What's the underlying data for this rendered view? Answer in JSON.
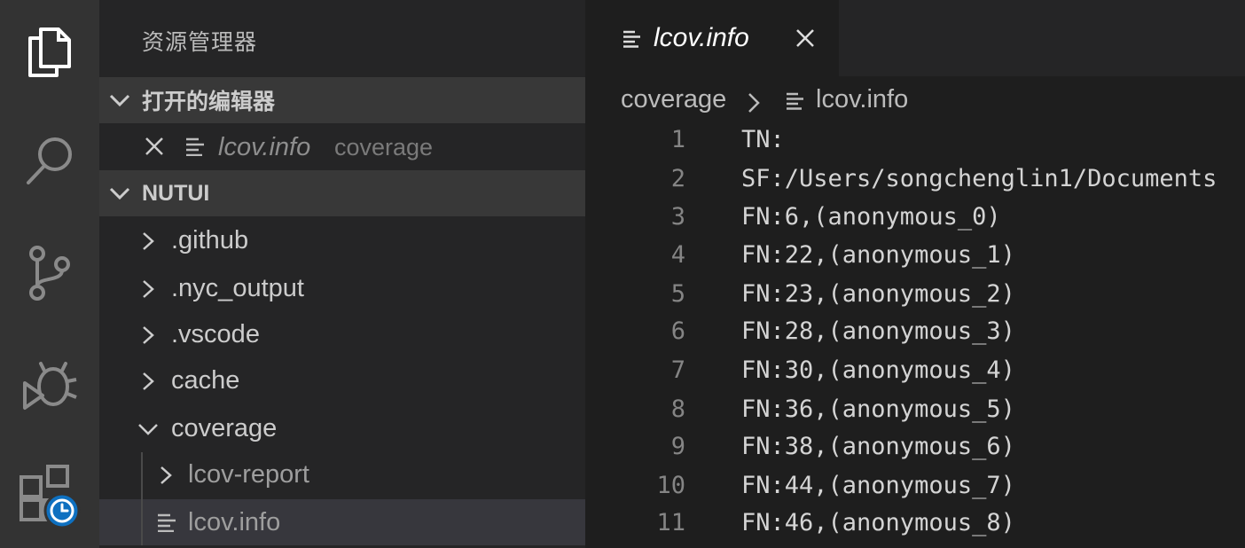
{
  "activity_bar": {
    "items": [
      {
        "name": "explorer-icon"
      },
      {
        "name": "search-icon"
      },
      {
        "name": "source-control-icon"
      },
      {
        "name": "debug-icon"
      },
      {
        "name": "extensions-icon"
      }
    ]
  },
  "sidebar": {
    "title": "资源管理器",
    "open_editors": {
      "header": "打开的编辑器",
      "items": [
        {
          "name": "lcov.info",
          "description": "coverage"
        }
      ]
    },
    "workspace": {
      "header": "NUTUI",
      "items": [
        {
          "label": ".github",
          "type": "folder",
          "expanded": false
        },
        {
          "label": ".nyc_output",
          "type": "folder",
          "expanded": false
        },
        {
          "label": ".vscode",
          "type": "folder",
          "expanded": false
        },
        {
          "label": "cache",
          "type": "folder",
          "expanded": false
        },
        {
          "label": "coverage",
          "type": "folder",
          "expanded": true
        },
        {
          "label": "lcov-report",
          "type": "folder",
          "expanded": false
        },
        {
          "label": "lcov.info",
          "type": "file",
          "selected": true
        }
      ]
    }
  },
  "editor": {
    "tab": {
      "label": "lcov.info"
    },
    "breadcrumb": {
      "folder": "coverage",
      "file": "lcov.info"
    },
    "lines": [
      {
        "n": "1",
        "text": "TN:"
      },
      {
        "n": "2",
        "text": "SF:/Users/songchenglin1/Documents"
      },
      {
        "n": "3",
        "text": "FN:6,(anonymous_0)"
      },
      {
        "n": "4",
        "text": "FN:22,(anonymous_1)"
      },
      {
        "n": "5",
        "text": "FN:23,(anonymous_2)"
      },
      {
        "n": "6",
        "text": "FN:28,(anonymous_3)"
      },
      {
        "n": "7",
        "text": "FN:30,(anonymous_4)"
      },
      {
        "n": "8",
        "text": "FN:36,(anonymous_5)"
      },
      {
        "n": "9",
        "text": "FN:38,(anonymous_6)"
      },
      {
        "n": "10",
        "text": "FN:44,(anonymous_7)"
      },
      {
        "n": "11",
        "text": "FN:46,(anonymous_8)"
      }
    ]
  },
  "colors": {
    "activity_bar": "#333333",
    "sidebar": "#252526",
    "editor": "#1e1e1e",
    "badge": "#0e70c0"
  }
}
